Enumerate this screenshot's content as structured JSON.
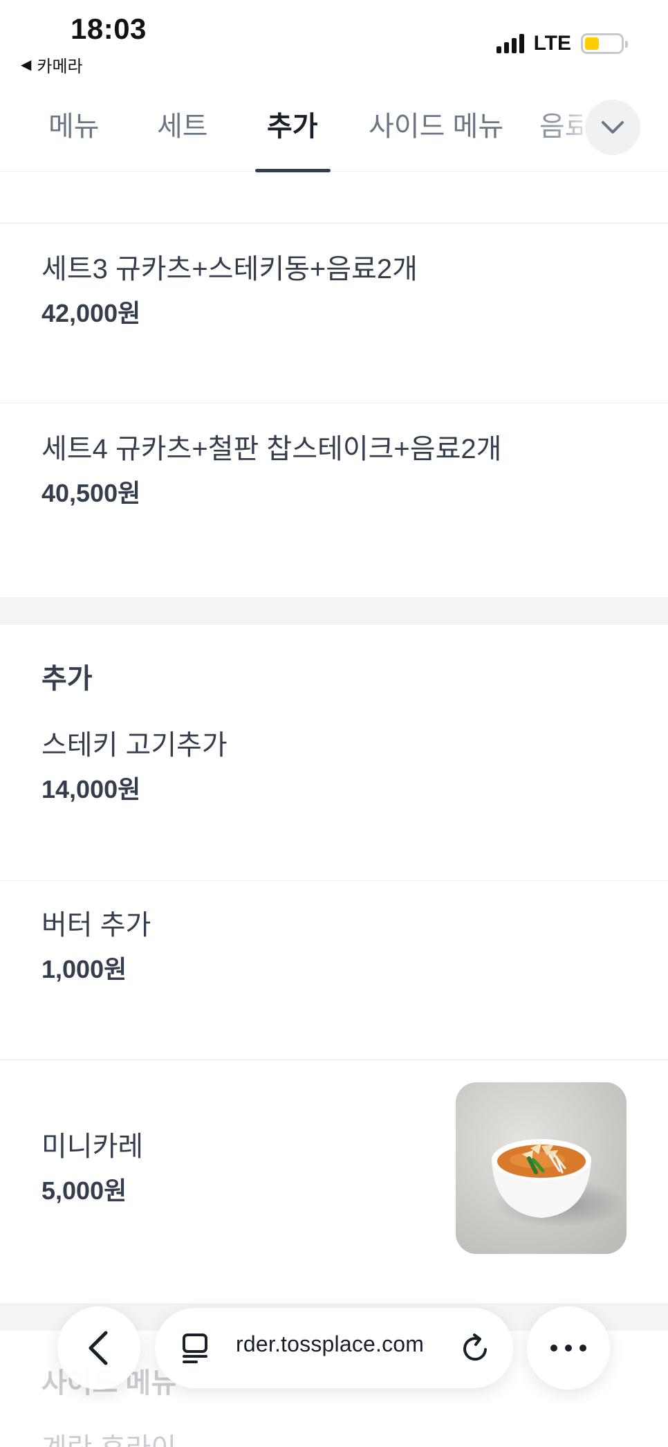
{
  "status_bar": {
    "time": "18:03",
    "back_app": "카메라",
    "network": "LTE",
    "battery_color": "#ffcc00"
  },
  "tabs": [
    {
      "label": "메뉴",
      "active": false
    },
    {
      "label": "세트",
      "active": false
    },
    {
      "label": "추가",
      "active": true
    },
    {
      "label": "사이드 메뉴",
      "active": false
    },
    {
      "label": "음료",
      "active": false
    }
  ],
  "items": [
    {
      "name": "세트3 규카츠+스테키동+음료2개",
      "price": "42,000원"
    },
    {
      "name": "세트4 규카츠+철판 찹스테이크+음료2개",
      "price": "40,500원"
    }
  ],
  "sections": [
    {
      "title": "추가",
      "items": [
        {
          "name": "스테키 고기추가",
          "price": "14,000원"
        },
        {
          "name": "버터 추가",
          "price": "1,000원"
        },
        {
          "name": "미니카레",
          "price": "5,000원",
          "image": "curry-bowl"
        }
      ]
    },
    {
      "title": "사이드 메뉴",
      "items": [
        {
          "name": "계란 후라이"
        }
      ]
    }
  ],
  "browser": {
    "url": "rder.tossplace.com",
    "icons": [
      "back-arrow-icon",
      "tabs-icon",
      "reload-icon",
      "more-icon"
    ]
  },
  "colors": {
    "text_primary": "#333d4b",
    "tab_inactive": "#6b7684",
    "section_gap": "#f2f4f6"
  }
}
